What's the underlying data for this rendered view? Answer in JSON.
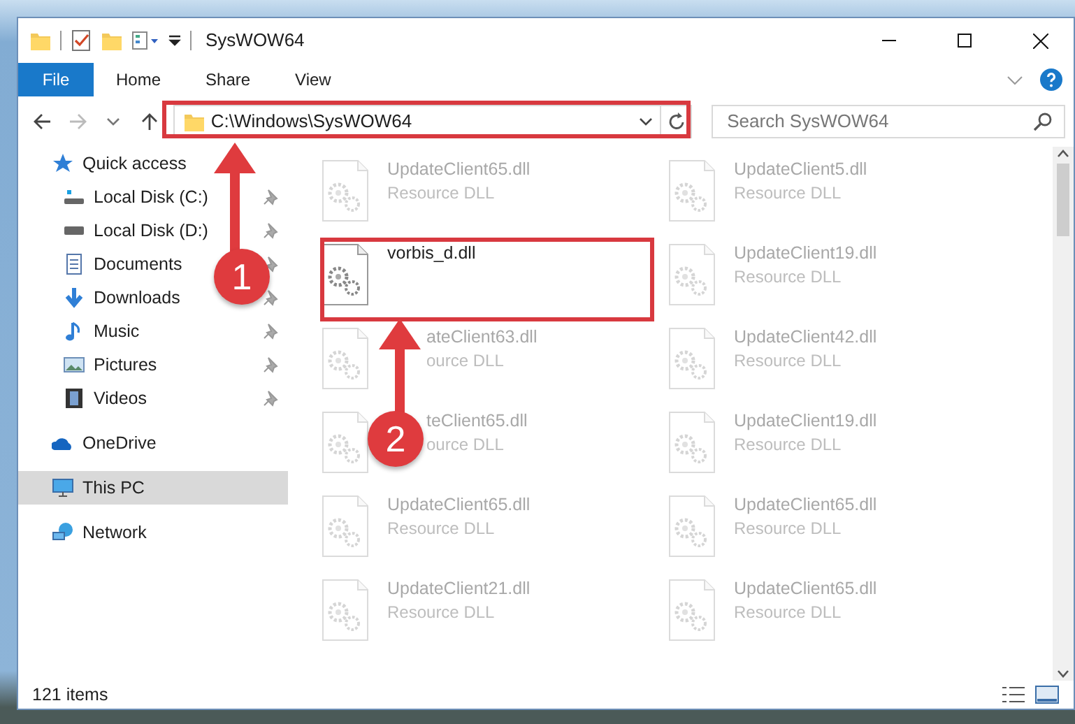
{
  "window": {
    "title": "SysWOW64"
  },
  "ribbon_tabs": [
    {
      "label": "File",
      "kind": "file"
    },
    {
      "label": "Home",
      "kind": "tab"
    },
    {
      "label": "Share",
      "kind": "tab"
    },
    {
      "label": "View",
      "kind": "tab"
    }
  ],
  "address_bar": {
    "path": "C:\\Windows\\SysWOW64"
  },
  "search": {
    "placeholder": "Search SysWOW64"
  },
  "nav": [
    {
      "label": "Quick access",
      "selected": false,
      "children": [
        {
          "label": "Local Disk (C:)",
          "pinned": true
        },
        {
          "label": "Local Disk (D:)",
          "pinned": true
        },
        {
          "label": "Documents",
          "pinned": true
        },
        {
          "label": "Downloads",
          "pinned": true
        },
        {
          "label": "Music",
          "pinned": true
        },
        {
          "label": "Pictures",
          "pinned": true
        },
        {
          "label": "Videos",
          "pinned": true
        }
      ]
    },
    {
      "label": "OneDrive",
      "selected": false
    },
    {
      "label": "This PC",
      "selected": true
    },
    {
      "label": "Network",
      "selected": false
    }
  ],
  "files": [
    {
      "name": "UpdateClient65.dll",
      "type": "Resource DLL",
      "faded": true
    },
    {
      "name": "UpdateClient5.dll",
      "type": "Resource DLL",
      "faded": true
    },
    {
      "name": "vorbis_d.dll",
      "faded": false
    },
    {
      "name": "UpdateClient19.dll",
      "type": "Resource DLL",
      "faded": true
    },
    {
      "name": "ateClient63.dll",
      "type": "ource DLL",
      "faded": true,
      "covered": true
    },
    {
      "name": "UpdateClient42.dll",
      "type": "Resource DLL",
      "faded": true
    },
    {
      "name": "teClient65.dll",
      "type": "ource DLL",
      "faded": true,
      "covered": true
    },
    {
      "name": "UpdateClient19.dll",
      "type": "Resource DLL",
      "faded": true
    },
    {
      "name": "UpdateClient65.dll",
      "type": "Resource DLL",
      "faded": true
    },
    {
      "name": "UpdateClient65.dll",
      "type": "Resource DLL",
      "faded": true
    },
    {
      "name": "UpdateClient21.dll",
      "type": "Resource DLL",
      "faded": true
    },
    {
      "name": "UpdateClient65.dll",
      "type": "Resource DLL",
      "faded": true
    }
  ],
  "status_bar": {
    "item_count": "121 items"
  },
  "annotations": [
    {
      "label": "1"
    },
    {
      "label": "2"
    }
  ]
}
